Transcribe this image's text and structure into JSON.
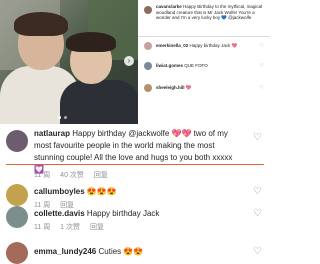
{
  "post_photo": {
    "alt": "Photo of two people"
  },
  "mini_comments": [
    {
      "username": "cavanclarke",
      "text": "Happy Birthday to the mythical, magical woodland creature that is Mr Jack Wolfe! You're a wonder and I'm a very lucky boy 💙 @jackwolfe",
      "avatar_color": "#8a6d5a"
    },
    {
      "username": "emerkinella_02",
      "text": "Happy birthday Jack 💖",
      "avatar_color": "#c9a0a0"
    },
    {
      "username": "liwiat.gomes",
      "text": "QUE FOFO",
      "avatar_color": "#7a8a9a"
    },
    {
      "username": "sheeleigh.hill",
      "text": "💖",
      "avatar_color": "#b58f6e"
    }
  ],
  "comments": [
    {
      "username": "natlaurap",
      "text": "Happy birthday @jackwolfe 💖💖 two of my most favourite people in the world making the most stunning couple! All the love and hugs to you both xxxxx 💟",
      "time": "11 周",
      "likes": "40 次赞",
      "reply": "回复",
      "avatar_color": "#6d5c6e"
    },
    {
      "username": "callumboyles",
      "text": "😍😍😍",
      "time": "11 周",
      "reply": "回复",
      "avatar_color": "#c2a24c"
    },
    {
      "username": "collette.davis",
      "text": "Happy birthday Jack",
      "time": "11 周",
      "likes": "1 次赞",
      "reply": "回复",
      "avatar_color": "#7c8f8c"
    },
    {
      "username": "emma_lundy246",
      "text": "Cuties 😍😍",
      "avatar_color": "#a46a5a"
    }
  ],
  "icons": {
    "heart": "heart-icon"
  }
}
